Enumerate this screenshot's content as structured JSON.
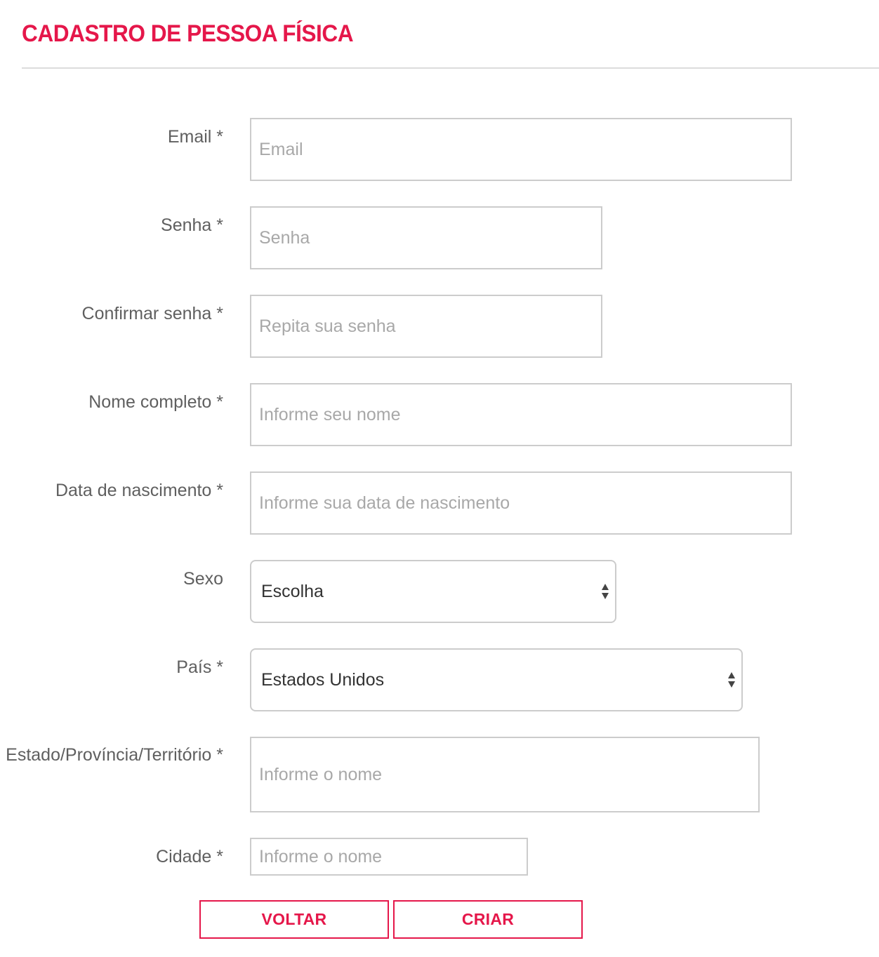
{
  "page": {
    "title": "CADASTRO DE PESSOA FÍSICA"
  },
  "form": {
    "email": {
      "label": "Email *",
      "placeholder": "Email",
      "value": ""
    },
    "senha": {
      "label": "Senha *",
      "placeholder": "Senha",
      "value": ""
    },
    "confirmar_senha": {
      "label": "Confirmar senha *",
      "placeholder": "Repita sua senha",
      "value": ""
    },
    "nome": {
      "label": "Nome completo *",
      "placeholder": "Informe seu nome",
      "value": ""
    },
    "nascimento": {
      "label": "Data de nascimento *",
      "placeholder": "Informe sua data de nascimento",
      "value": ""
    },
    "sexo": {
      "label": "Sexo",
      "selected": "Escolha"
    },
    "pais": {
      "label": "País *",
      "selected": "Estados Unidos"
    },
    "estado": {
      "label": "Estado/Província/Território *",
      "placeholder": "Informe o nome",
      "value": ""
    },
    "cidade": {
      "label": "Cidade *",
      "placeholder": "Informe o nome",
      "value": ""
    }
  },
  "buttons": {
    "back": "VOLTAR",
    "create": "CRIAR"
  },
  "icons": {
    "select_arrows": "up-down-arrows-icon"
  },
  "colors": {
    "accent": "#e5174a",
    "label": "#5f5f5f",
    "placeholder": "#a8a8a8",
    "border": "#cccccc"
  }
}
